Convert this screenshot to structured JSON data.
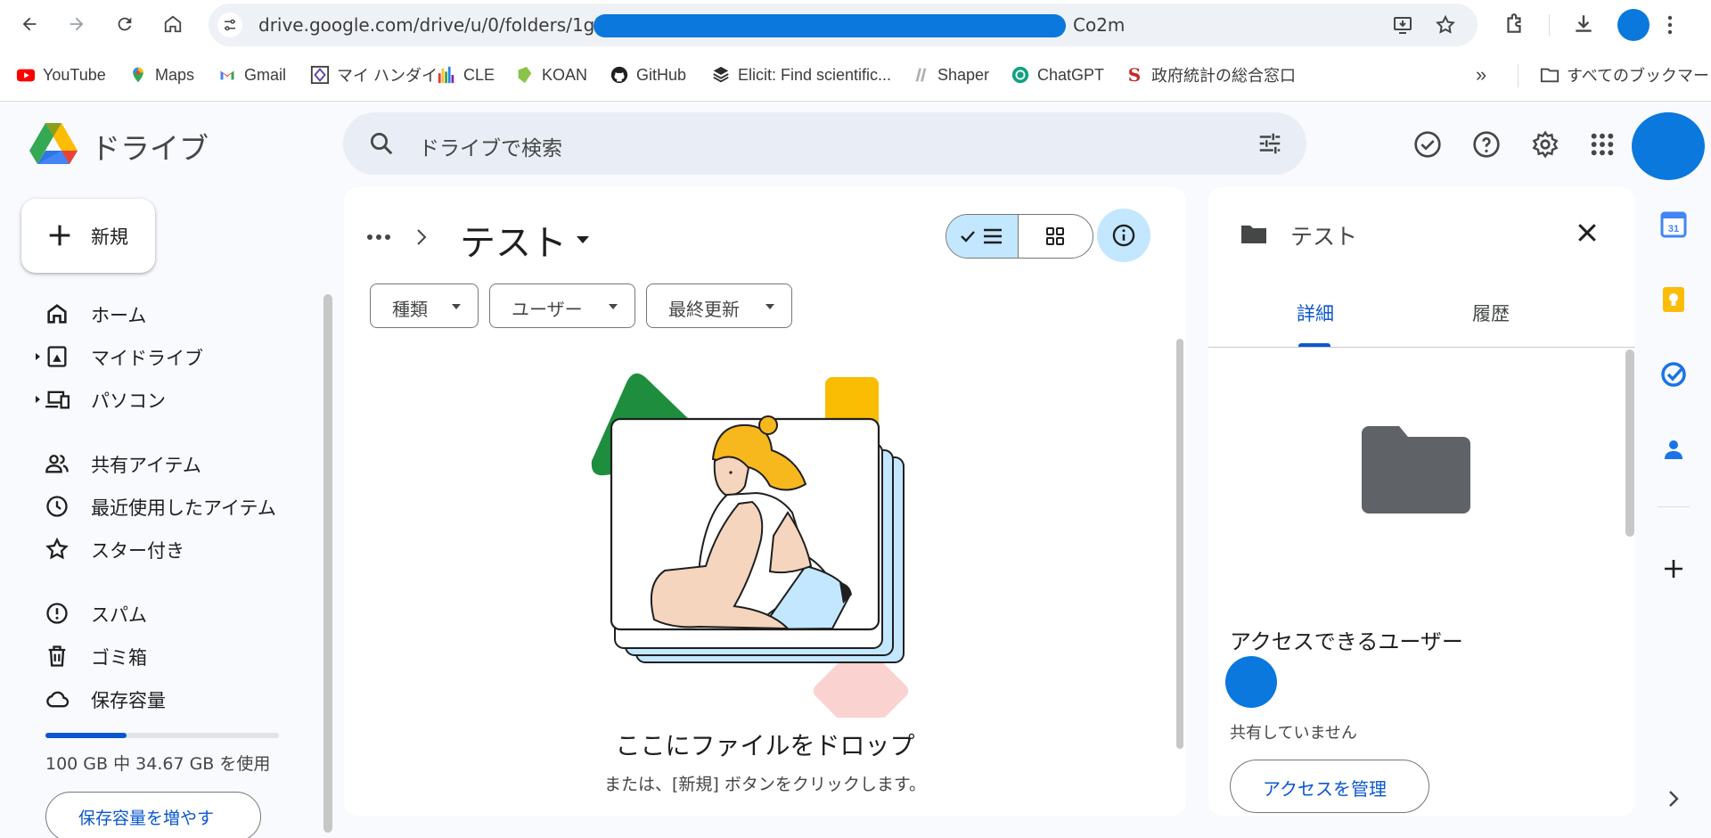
{
  "browser": {
    "url_prefix": "drive.google.com/drive/u/0/folders/1gDr",
    "url_suffix": "Co2m",
    "bookmarks": [
      {
        "label": "YouTube",
        "icon": "youtube-icon"
      },
      {
        "label": "Maps",
        "icon": "maps-icon"
      },
      {
        "label": "Gmail",
        "icon": "gmail-icon"
      },
      {
        "label": "マイ ハンダイ",
        "icon": "my-handai-icon"
      },
      {
        "label": "CLE",
        "icon": "cle-icon"
      },
      {
        "label": "KOAN",
        "icon": "koan-icon"
      },
      {
        "label": "GitHub",
        "icon": "github-icon"
      },
      {
        "label": "Elicit: Find scientific...",
        "icon": "elicit-icon"
      },
      {
        "label": "Shaper",
        "icon": "shaper-icon"
      },
      {
        "label": "ChatGPT",
        "icon": "chatgpt-icon"
      },
      {
        "label": "政府統計の総合窓口",
        "icon": "estat-icon"
      }
    ],
    "all_bookmarks_label": "すべてのブックマーク"
  },
  "header": {
    "app_title": "ドライブ",
    "search_placeholder": "ドライブで検索"
  },
  "sidebar": {
    "new_label": "新規",
    "items": [
      {
        "label": "ホーム",
        "icon": "home-icon"
      },
      {
        "label": "マイドライブ",
        "icon": "my-drive-icon"
      },
      {
        "label": "パソコン",
        "icon": "computers-icon"
      },
      {
        "label": "共有アイテム",
        "icon": "shared-icon"
      },
      {
        "label": "最近使用したアイテム",
        "icon": "recent-icon"
      },
      {
        "label": "スター付き",
        "icon": "star-icon"
      },
      {
        "label": "スパム",
        "icon": "spam-icon"
      },
      {
        "label": "ゴミ箱",
        "icon": "trash-icon"
      },
      {
        "label": "保存容量",
        "icon": "cloud-icon"
      }
    ],
    "storage_used_fraction": 0.3467,
    "storage_text": "100 GB 中 34.67 GB を使用",
    "storage_button": "保存容量を増やす"
  },
  "main": {
    "folder_title": "テスト",
    "filters": [
      "種類",
      "ユーザー",
      "最終更新"
    ],
    "drop_title": "ここにファイルをドロップ",
    "drop_subtitle": "または、[新規] ボタンをクリックします。"
  },
  "details": {
    "title": "テスト",
    "tabs": [
      "詳細",
      "履歴"
    ],
    "active_tab": "詳細",
    "access_title": "アクセスできるユーザー",
    "not_shared": "共有していません",
    "manage_button": "アクセスを管理"
  },
  "colors": {
    "accent": "#0b57d0",
    "selected": "#c2e7ff",
    "redaction": "#0a78dc"
  }
}
